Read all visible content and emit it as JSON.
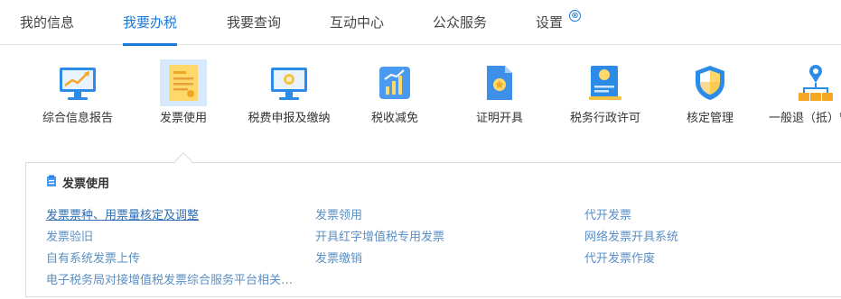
{
  "topnav": {
    "tabs": [
      "我的信息",
      "我要办税",
      "我要查询",
      "互动中心",
      "公众服务",
      "设置"
    ],
    "active_tab": "我要办税",
    "close_glyph": "⊗"
  },
  "services": [
    {
      "label": "综合信息报告",
      "icon": "monitor-chart-icon"
    },
    {
      "label": "发票使用",
      "icon": "invoice-document-icon"
    },
    {
      "label": "税费申报及缴纳",
      "icon": "monitor-coin-icon"
    },
    {
      "label": "税收减免",
      "icon": "bar-chart-icon"
    },
    {
      "label": "证明开具",
      "icon": "certificate-file-icon"
    },
    {
      "label": "税务行政许可",
      "icon": "license-certificate-icon"
    },
    {
      "label": "核定管理",
      "icon": "shield-icon"
    },
    {
      "label": "一般退（抵）管理",
      "icon": "org-location-icon"
    }
  ],
  "panel": {
    "title": "发票使用",
    "links": {
      "col1": [
        "发票票种、用票量核定及调整",
        "发票验旧",
        "自有系统发票上传",
        "电子税务局对接增值税发票综合服务平台相关…"
      ],
      "col2": [
        "发票领用",
        "开具红字增值税专用发票",
        "发票缴销"
      ],
      "col3": [
        "代开发票",
        "网络发票开具系统",
        "代开发票作废"
      ]
    }
  },
  "colors": {
    "accent": "#1a7ad9",
    "link": "#5b8fc4",
    "link_primary": "#2f6db5"
  }
}
